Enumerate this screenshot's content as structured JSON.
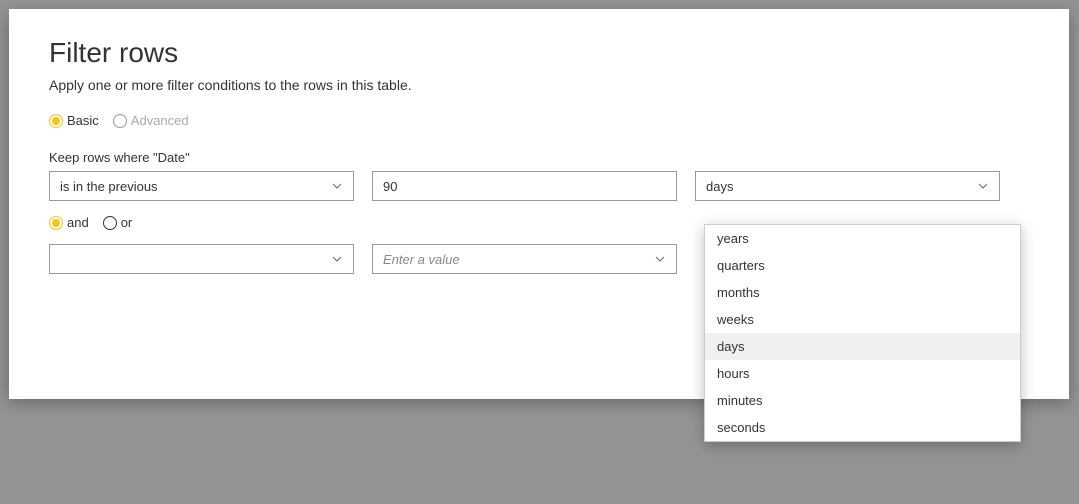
{
  "dialog": {
    "title": "Filter rows",
    "subtitle": "Apply one or more filter conditions to the rows in this table."
  },
  "mode": {
    "basic": "Basic",
    "advanced": "Advanced"
  },
  "keep_label": "Keep rows where \"Date\"",
  "row1": {
    "operator": "is in the previous",
    "value": "90",
    "unit": "days"
  },
  "logic": {
    "and": "and",
    "or": "or"
  },
  "row2": {
    "operator": "",
    "value_placeholder": "Enter a value",
    "unit": ""
  },
  "unit_options": [
    "years",
    "quarters",
    "months",
    "weeks",
    "days",
    "hours",
    "minutes",
    "seconds"
  ],
  "unit_selected": "days"
}
